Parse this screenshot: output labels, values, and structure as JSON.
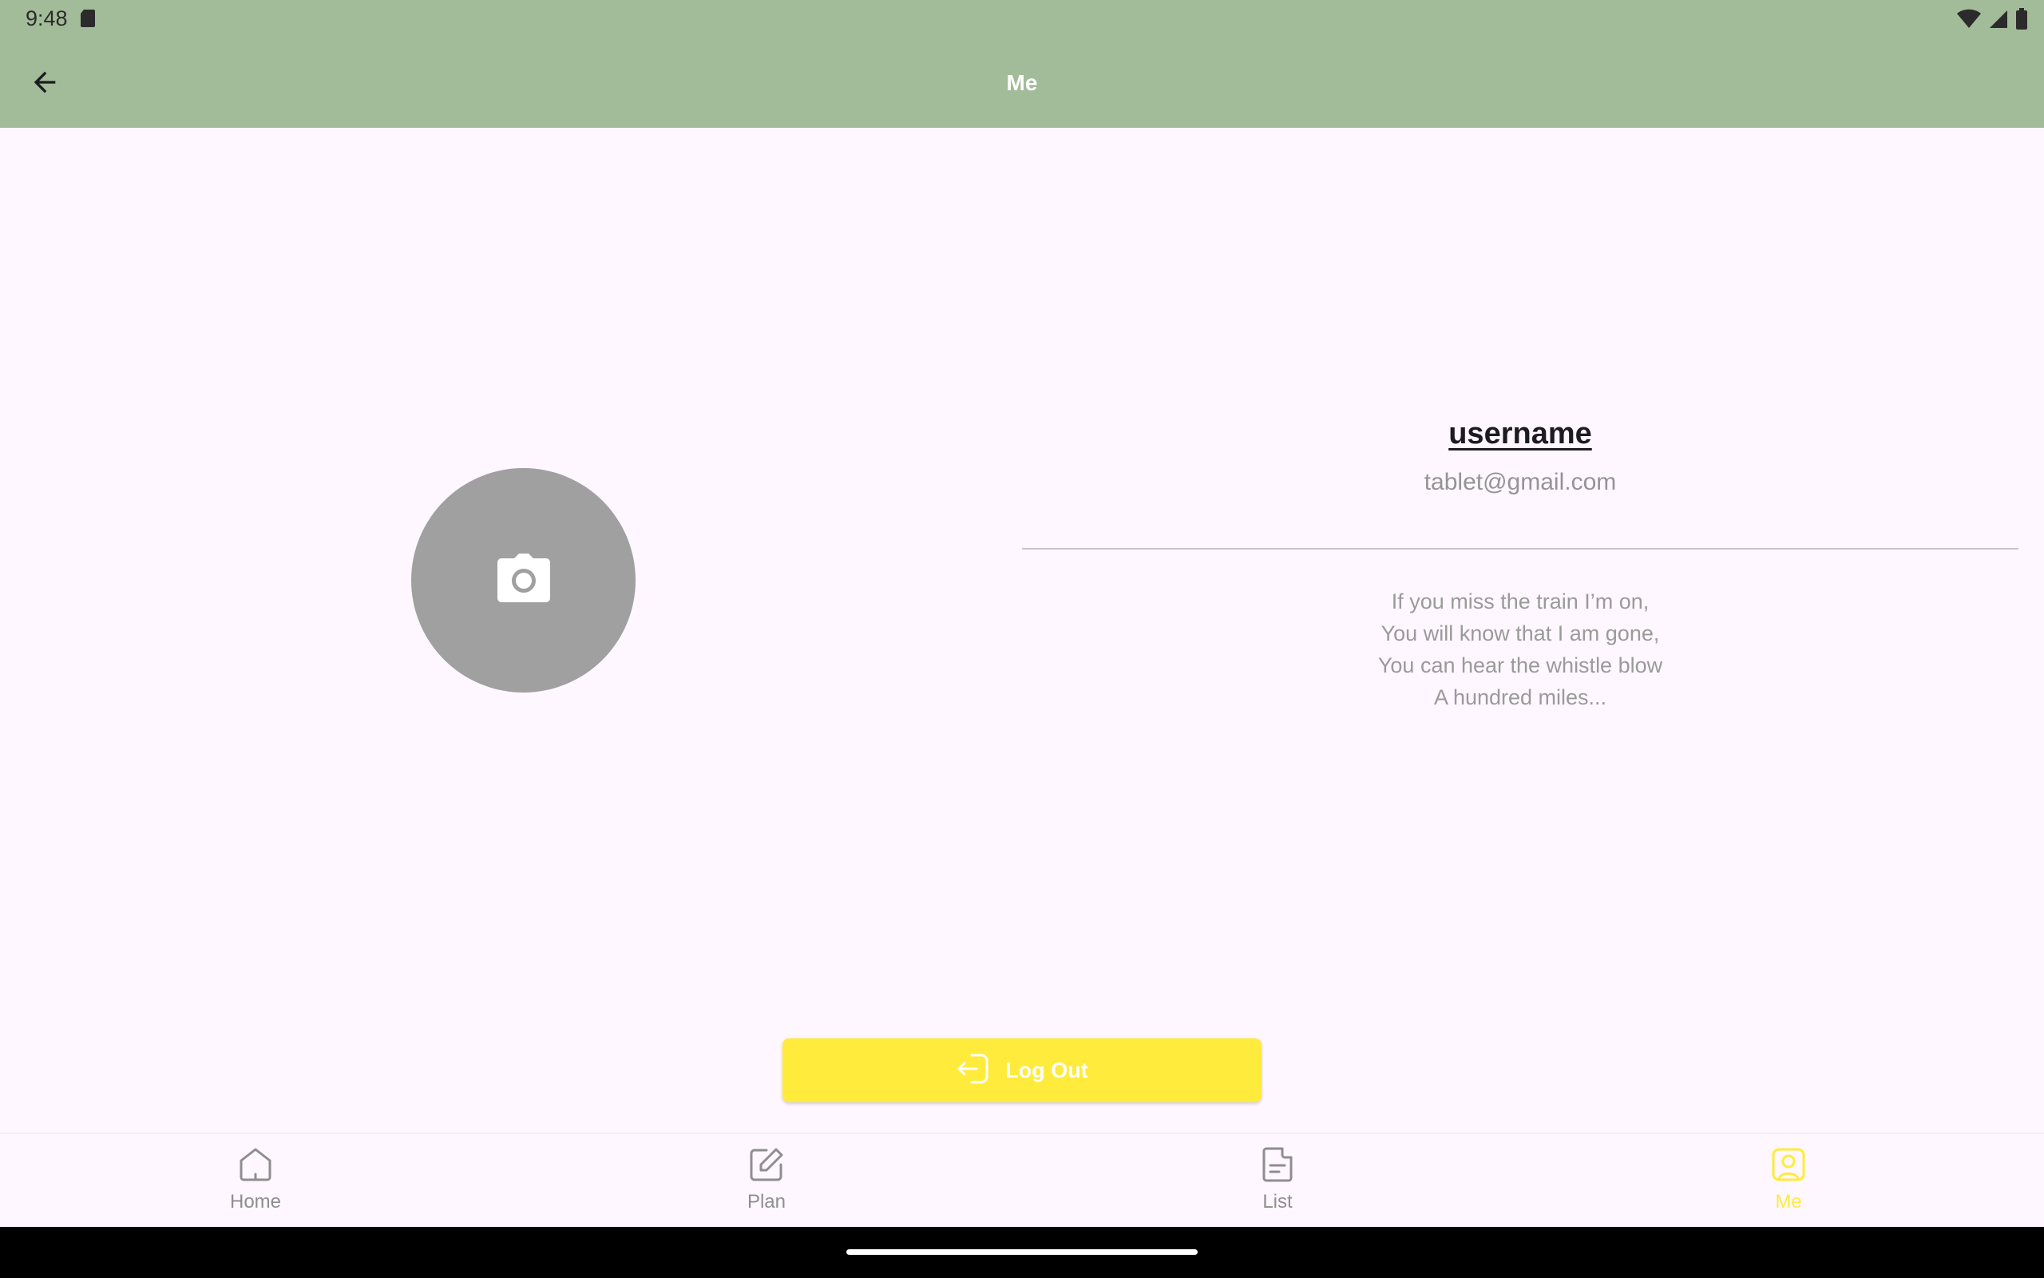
{
  "status_bar": {
    "time": "9:48"
  },
  "app_bar": {
    "title": "Me",
    "back_icon": "arrow-back-icon"
  },
  "profile": {
    "avatar_icon": "camera-icon",
    "username": "username",
    "email": "tablet@gmail.com",
    "bio": "If you miss the train I’m on,\nYou will know that I am gone,\nYou can hear the whistle blow\nA hundred miles..."
  },
  "logout": {
    "label": "Log Out",
    "icon": "logout-icon"
  },
  "bottom_nav": {
    "items": [
      {
        "label": "Home",
        "icon": "home-icon",
        "active": false
      },
      {
        "label": "Plan",
        "icon": "edit-icon",
        "active": false
      },
      {
        "label": "List",
        "icon": "document-icon",
        "active": false
      },
      {
        "label": "Me",
        "icon": "user-icon",
        "active": true
      }
    ]
  },
  "colors": {
    "app_bar_bg": "#A2BC99",
    "page_bg": "#FEF7FF",
    "accent": "#FFEB3B",
    "avatar_bg": "#A0A0A0",
    "muted_text": "#949494",
    "nav_inactive": "#8E8E8E"
  }
}
